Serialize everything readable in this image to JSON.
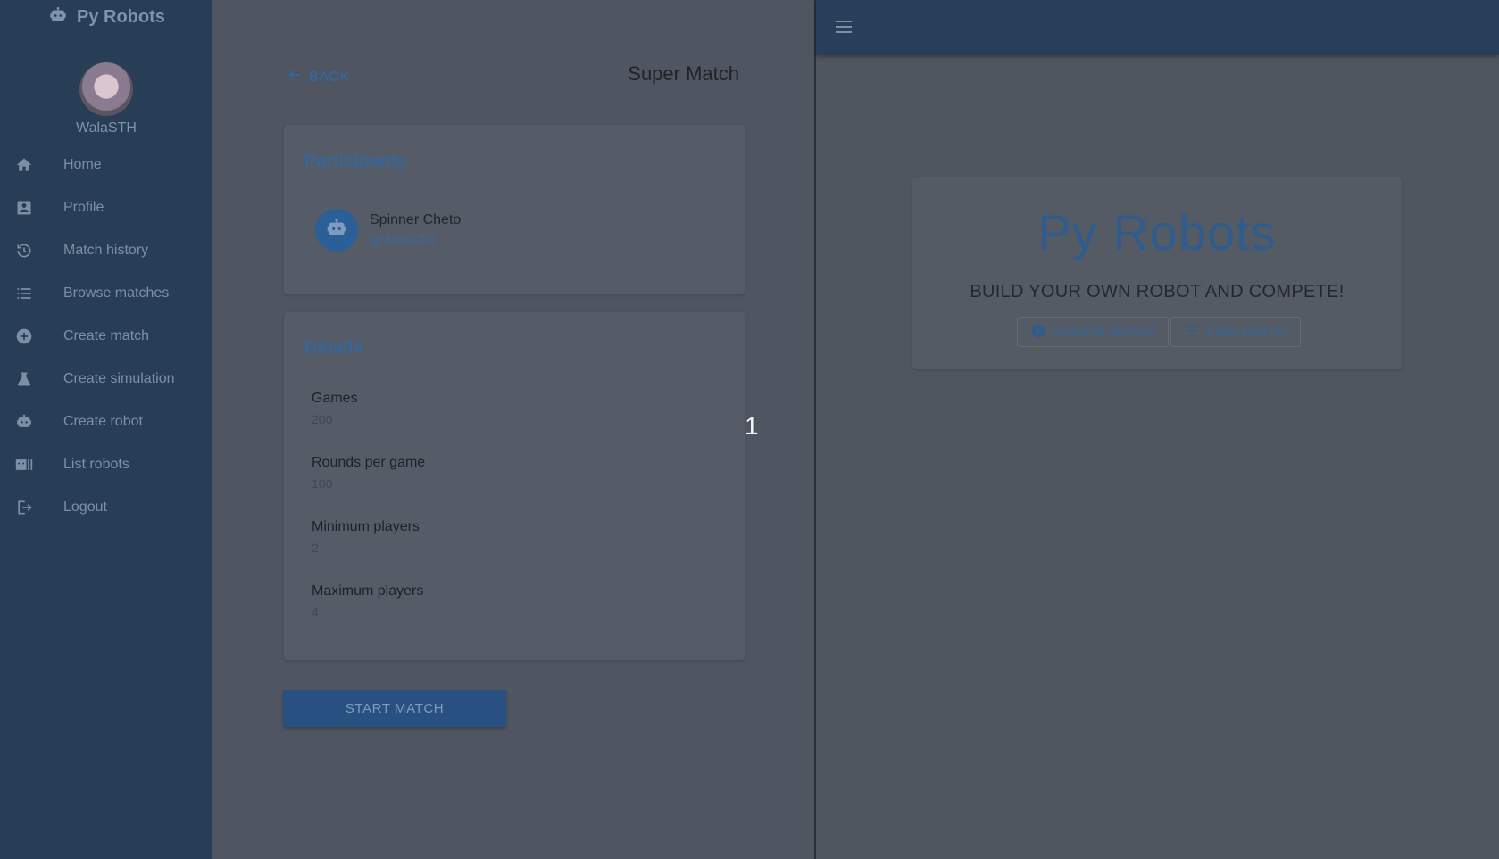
{
  "app": {
    "name": "Py Robots"
  },
  "user": {
    "username": "WalaSTH"
  },
  "nav": {
    "items": [
      {
        "label": "Home",
        "icon": "home-icon"
      },
      {
        "label": "Profile",
        "icon": "profile-icon"
      },
      {
        "label": "Match history",
        "icon": "history-icon"
      },
      {
        "label": "Browse matches",
        "icon": "list-icon"
      },
      {
        "label": "Create match",
        "icon": "add-circle-icon"
      },
      {
        "label": "Create simulation",
        "icon": "flask-icon"
      },
      {
        "label": "Create robot",
        "icon": "robot-icon"
      },
      {
        "label": "List robots",
        "icon": "robot-list-icon"
      },
      {
        "label": "Logout",
        "icon": "logout-icon"
      }
    ]
  },
  "match": {
    "back_label": "BACK",
    "title": "Super Match",
    "participants_title": "Participants",
    "participants": [
      {
        "robot": "Spinner Cheto",
        "handle": "@WalaSTH"
      }
    ],
    "details_title": "Details",
    "details": [
      {
        "label": "Games",
        "value": "200"
      },
      {
        "label": "Rounds per game",
        "value": "100"
      },
      {
        "label": "Minimum players",
        "value": "2"
      },
      {
        "label": "Maximum players",
        "value": "4"
      }
    ],
    "start_label": "START MATCH",
    "overlay_number": "1"
  },
  "home": {
    "title": "Py Robots",
    "subtitle": "BUILD YOUR OWN ROBOT AND COMPETE!",
    "create_match_label": "CREATE MATCH",
    "find_match_label": "FIND MATCH"
  },
  "colors": {
    "sidebar": "#283e57",
    "topbar": "#273f5b",
    "accent": "#2f6aa8",
    "start_button": "#285081"
  }
}
